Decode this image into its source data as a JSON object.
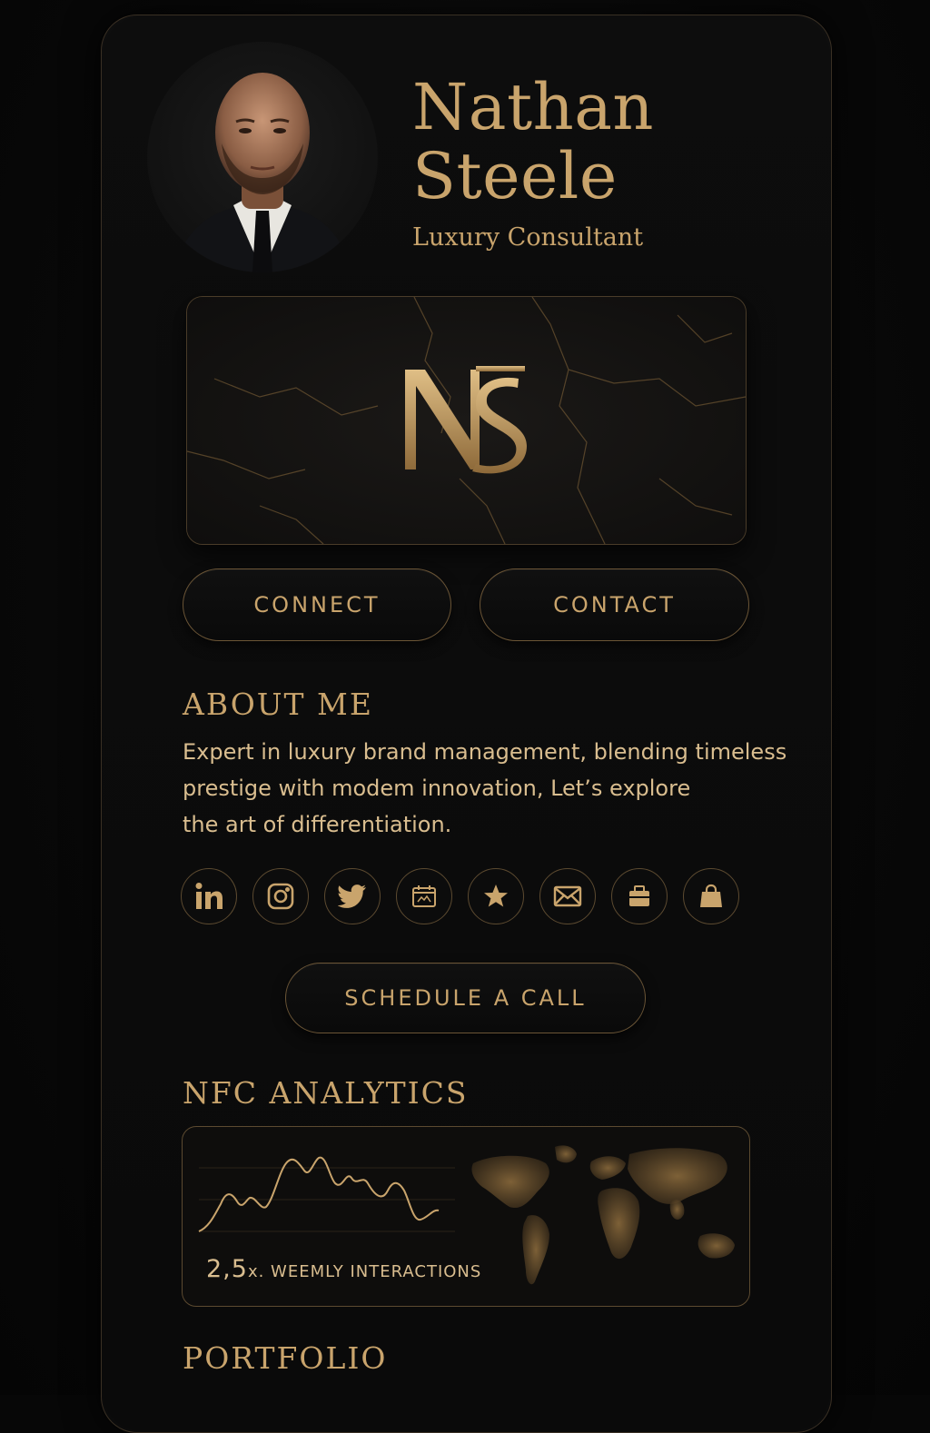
{
  "profile": {
    "name_line1": "Nathan",
    "name_line2": "Steele",
    "role": "Luxury Consultant",
    "monogram": "NS"
  },
  "actions": {
    "connect_label": "CONNECT",
    "contact_label": "CONTACT",
    "schedule_label": "SCHEDULE A CALL"
  },
  "about": {
    "title": "ABOUT ME",
    "line1": "Expert in luxury brand management, blending timeless",
    "line2": "prestige with modem innovation, Let’s explore",
    "line3": "the art of differentiation."
  },
  "social_icons": [
    "linkedin-icon",
    "instagram-icon",
    "twitter-icon",
    "calendar-icon",
    "star-icon",
    "mail-icon",
    "briefcase-icon",
    "shopping-bag-icon"
  ],
  "analytics": {
    "title": "NFC ANALYTICS",
    "stat_value": "2,5",
    "stat_label": "x. WEEMLY INTERACTIONS"
  },
  "portfolio": {
    "title": "PORTFOLIO"
  },
  "colors": {
    "gold": "#c9a46c",
    "background": "#0a0a0a"
  }
}
